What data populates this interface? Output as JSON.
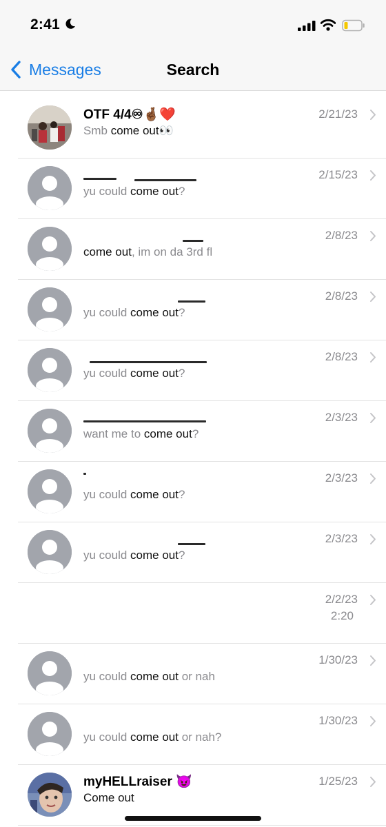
{
  "status_bar": {
    "time": "2:41"
  },
  "nav": {
    "back_label": "Messages",
    "title": "Search"
  },
  "threads": [
    {
      "name": "OTF 4/4♾🤞🏾❤️",
      "preview_before": "Smb ",
      "preview_match": "come out",
      "preview_after": "👀",
      "date": "2/21/23",
      "avatar": "group-photo"
    },
    {
      "name": "",
      "preview_before": "yu could ",
      "preview_match": "come out",
      "preview_after": "?",
      "date": "2/15/23",
      "avatar": "default"
    },
    {
      "name": "",
      "preview_before": "",
      "preview_match": "come out",
      "preview_after": ", im on da 3rd fl",
      "date": "2/8/23",
      "avatar": "default"
    },
    {
      "name": "",
      "preview_before": "yu could ",
      "preview_match": "come out",
      "preview_after": "?",
      "date": "2/8/23",
      "avatar": "default"
    },
    {
      "name": "",
      "preview_before": "yu could ",
      "preview_match": "come out",
      "preview_after": "?",
      "date": "2/8/23",
      "avatar": "default"
    },
    {
      "name": "",
      "preview_before": "want me to ",
      "preview_match": "come out",
      "preview_after": "?",
      "date": "2/3/23",
      "avatar": "default"
    },
    {
      "name": "",
      "preview_before": "yu could ",
      "preview_match": "come out",
      "preview_after": "?",
      "date": "2/3/23",
      "avatar": "default"
    },
    {
      "name": "",
      "preview_before": "yu could ",
      "preview_match": "come out",
      "preview_after": "?",
      "date": "2/3/23",
      "avatar": "default"
    },
    {
      "name": "",
      "preview_before": "",
      "preview_match": "",
      "preview_after": "",
      "date": "2/2/23",
      "time": "2:20",
      "avatar": "none"
    },
    {
      "name": "",
      "preview_before": "yu could ",
      "preview_match": "come out",
      "preview_after": " or nah",
      "date": "1/30/23",
      "avatar": "default"
    },
    {
      "name": "",
      "preview_before": "yu could ",
      "preview_match": "come out",
      "preview_after": " or nah?",
      "date": "1/30/23",
      "avatar": "default"
    },
    {
      "name": "myHELLraiser 😈",
      "preview_before": "",
      "preview_match": "Come out",
      "preview_after": "",
      "date": "1/25/23",
      "avatar": "person-photo"
    }
  ],
  "colors": {
    "accent": "#1a7ee5",
    "secondary_text": "#8a8a8e",
    "avatar_gray": "#a2a5ac",
    "battery_fill": "#f5c800"
  },
  "icons": [
    "moon-icon",
    "cellular-signal-icon",
    "wifi-icon",
    "battery-icon",
    "back-chevron-icon",
    "person-icon",
    "disclosure-chevron-icon"
  ]
}
